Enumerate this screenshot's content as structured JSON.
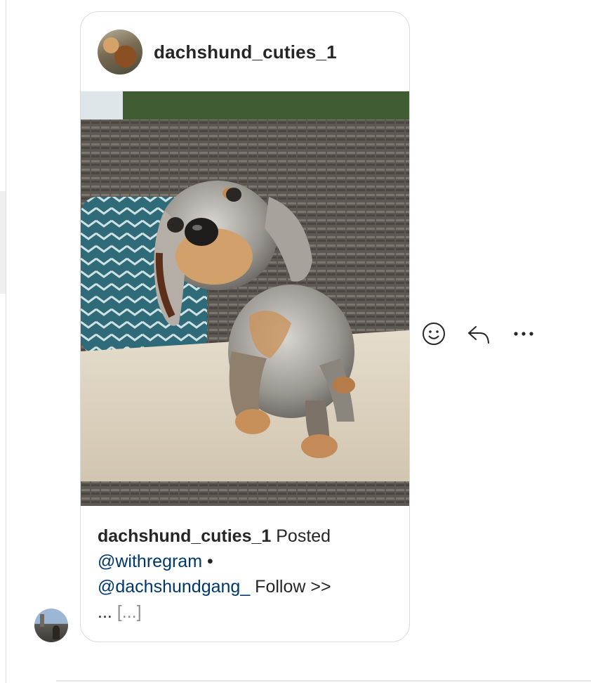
{
  "post": {
    "username": "dachshund_cuties_1",
    "image_alt": "dapple dachshund puppy standing on a wicker patio bench cushion",
    "caption": {
      "username": "dachshund_cuties_1",
      "text1": " Posted",
      "mention1": "@withregram",
      "separator": " •",
      "mention2": "@dachshundgang_",
      "text2": " Follow >>",
      "ellipsis": "... ",
      "more": "[...]"
    }
  },
  "message_actions": {
    "react_icon": "smiley-face-icon",
    "reply_icon": "reply-arrow-icon",
    "more_icon": "more-options-icon"
  },
  "colors": {
    "text": "#262626",
    "mention": "#00376b",
    "muted": "#8e8e8e",
    "card_border": "#dbdbdb"
  }
}
